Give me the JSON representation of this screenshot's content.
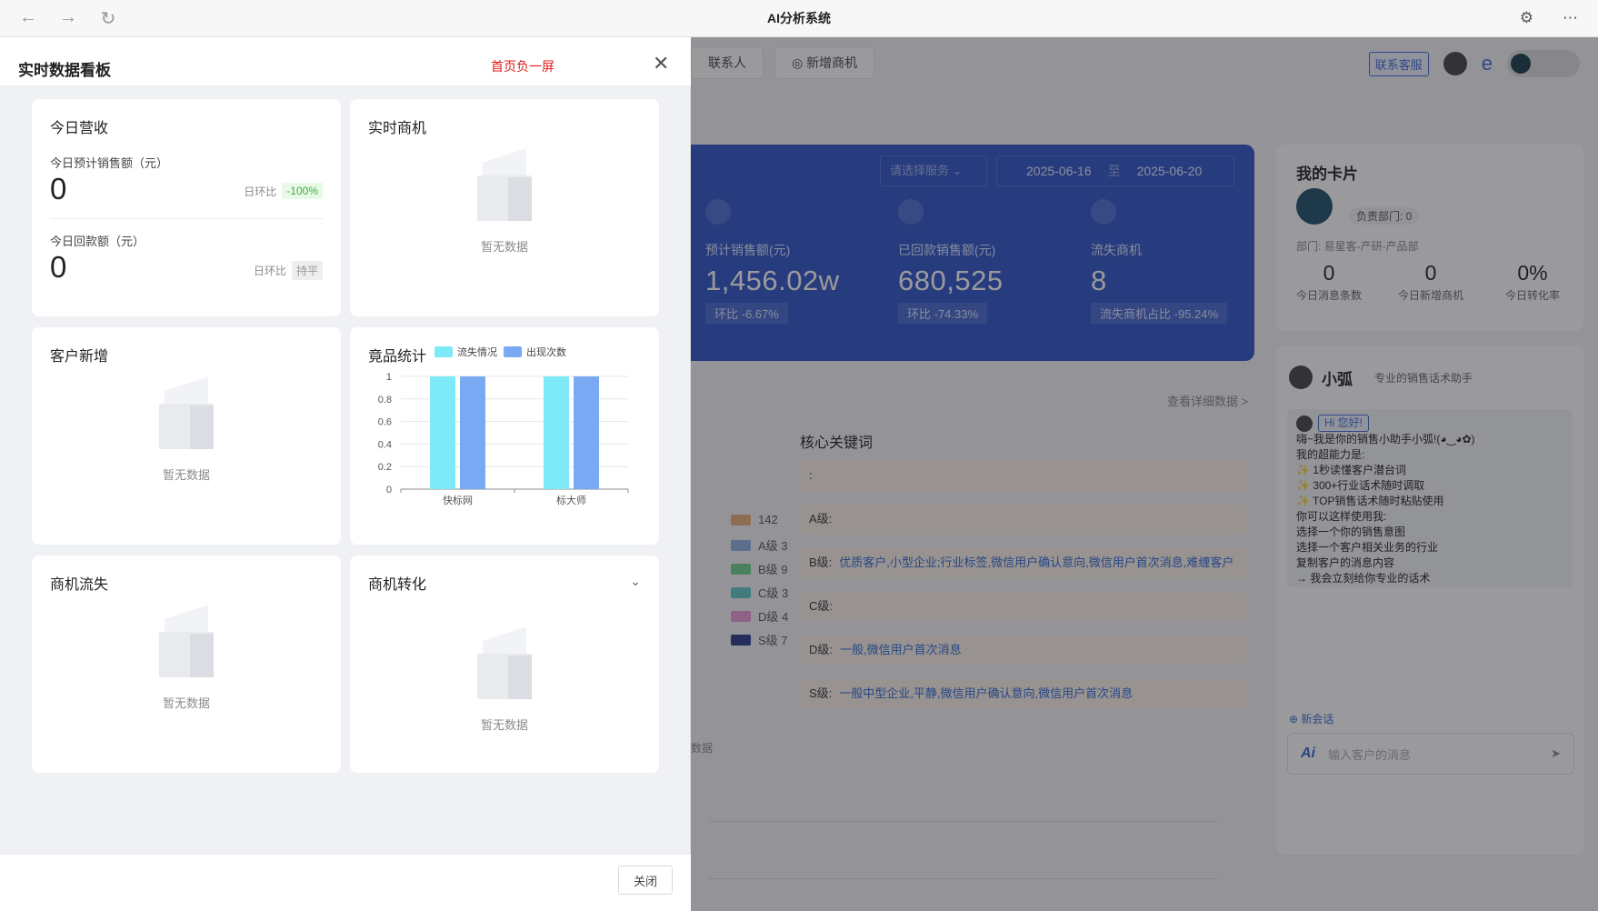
{
  "window": {
    "title": "AI分析系统"
  },
  "background": {
    "tabs": [
      "联系人",
      "新增商机"
    ],
    "service_label": "联系客服",
    "blue_panel": {
      "service_placeholder": "请选择服务",
      "date_start": "2025-06-16",
      "date_sep": "至",
      "date_end": "2025-06-20",
      "kpis": [
        {
          "label": "预计销售额(元)",
          "value": "1,456.02w",
          "badge": "环比 -6.67%"
        },
        {
          "label": "已回款销售额(元)",
          "value": "680,525",
          "badge": "环比 -74.33%"
        },
        {
          "label": "流失商机",
          "value": "8",
          "badge": "流失商机占比 -95.24%"
        }
      ]
    },
    "more_link": "查看详细数据 >",
    "keywords_title": "核心关键词",
    "keyword_rows": [
      {
        "level": ":",
        "words": ""
      },
      {
        "level": "A级:",
        "words": ""
      },
      {
        "level": "B级:",
        "words": "优质客户,小型企业;行业标签,微信用户确认意向,微信用户首次消息,难缠客户"
      },
      {
        "level": "C级:",
        "words": ""
      },
      {
        "level": "D级:",
        "words": "一般,微信用户首次消息"
      },
      {
        "level": "S级:",
        "words": "一般中型企业,平静,微信用户确认意向,微信用户首次消息"
      }
    ],
    "legend": [
      {
        "label": "142",
        "color": "#e8b07a"
      },
      {
        "label": "A级 3",
        "color": "#8fb0e6"
      },
      {
        "label": "B级 9",
        "color": "#6fcf8a"
      },
      {
        "label": "C级 3",
        "color": "#5fc7c9"
      },
      {
        "label": "D级 4",
        "color": "#e79ad8"
      },
      {
        "label": "S级 7",
        "color": "#2a3a8a"
      }
    ],
    "footer_text": "数据",
    "my_card": {
      "title": "我的卡片",
      "dept_badge": "负责部门: 0",
      "dept_line": "部门: 易星客-产研-产品部",
      "stats": [
        {
          "value": "0",
          "label": "今日消息条数"
        },
        {
          "value": "0",
          "label": "今日新增商机"
        },
        {
          "value": "0%",
          "label": "今日转化率"
        }
      ]
    },
    "assistant": {
      "name": "小弧",
      "tagline": "专业的销售话术助手",
      "greeting_badge": "Hi 您好!",
      "lines": [
        "嗨~我是你的销售小助手小弧!(◕‿◕✿)",
        "我的超能力是:",
        "✨ 1秒读懂客户潜台词",
        "✨ 300+行业话术随时调取",
        "✨ TOP销售话术随时粘贴使用",
        "你可以这样使用我:",
        "选择一个你的销售意图",
        "选择一个客户相关业务的行业",
        "复制客户的消息内容",
        "→ 我会立刻给你专业的话术"
      ],
      "new_chat": "新会话",
      "input_placeholder": "输入客户的消息",
      "ai_mark": "Ai"
    }
  },
  "modal": {
    "title": "实时数据看板",
    "tag": "首页负一屏",
    "close_label": "关闭",
    "empty_text": "暂无数据",
    "cards": {
      "revenue": {
        "title": "今日营收",
        "sales_label": "今日预计销售额（元）",
        "sales_value": "0",
        "sales_ring_label": "日环比",
        "sales_ring_value": "-100%",
        "payback_label": "今日回款额（元）",
        "payback_value": "0",
        "payback_ring_label": "日环比",
        "payback_ring_value": "持平"
      },
      "realtime_opportunity": {
        "title": "实时商机"
      },
      "new_customers": {
        "title": "客户新增"
      },
      "competitor": {
        "title": "竟品统计"
      },
      "opportunity_loss": {
        "title": "商机流失"
      },
      "opportunity_conversion": {
        "title": "商机转化"
      }
    }
  },
  "chart_data": {
    "type": "bar",
    "title": "竟品统计",
    "categories": [
      "快标网",
      "标大师"
    ],
    "series": [
      {
        "name": "流失情况",
        "values": [
          1,
          1
        ],
        "color": "#7eeaf7"
      },
      {
        "name": "出现次数",
        "values": [
          1,
          1
        ],
        "color": "#79a9f2"
      }
    ],
    "ylim": [
      0,
      1
    ],
    "yticks": [
      "0",
      "0.2",
      "0.4",
      "0.6",
      "0.8",
      "1"
    ],
    "grid": true,
    "legend": "top"
  }
}
